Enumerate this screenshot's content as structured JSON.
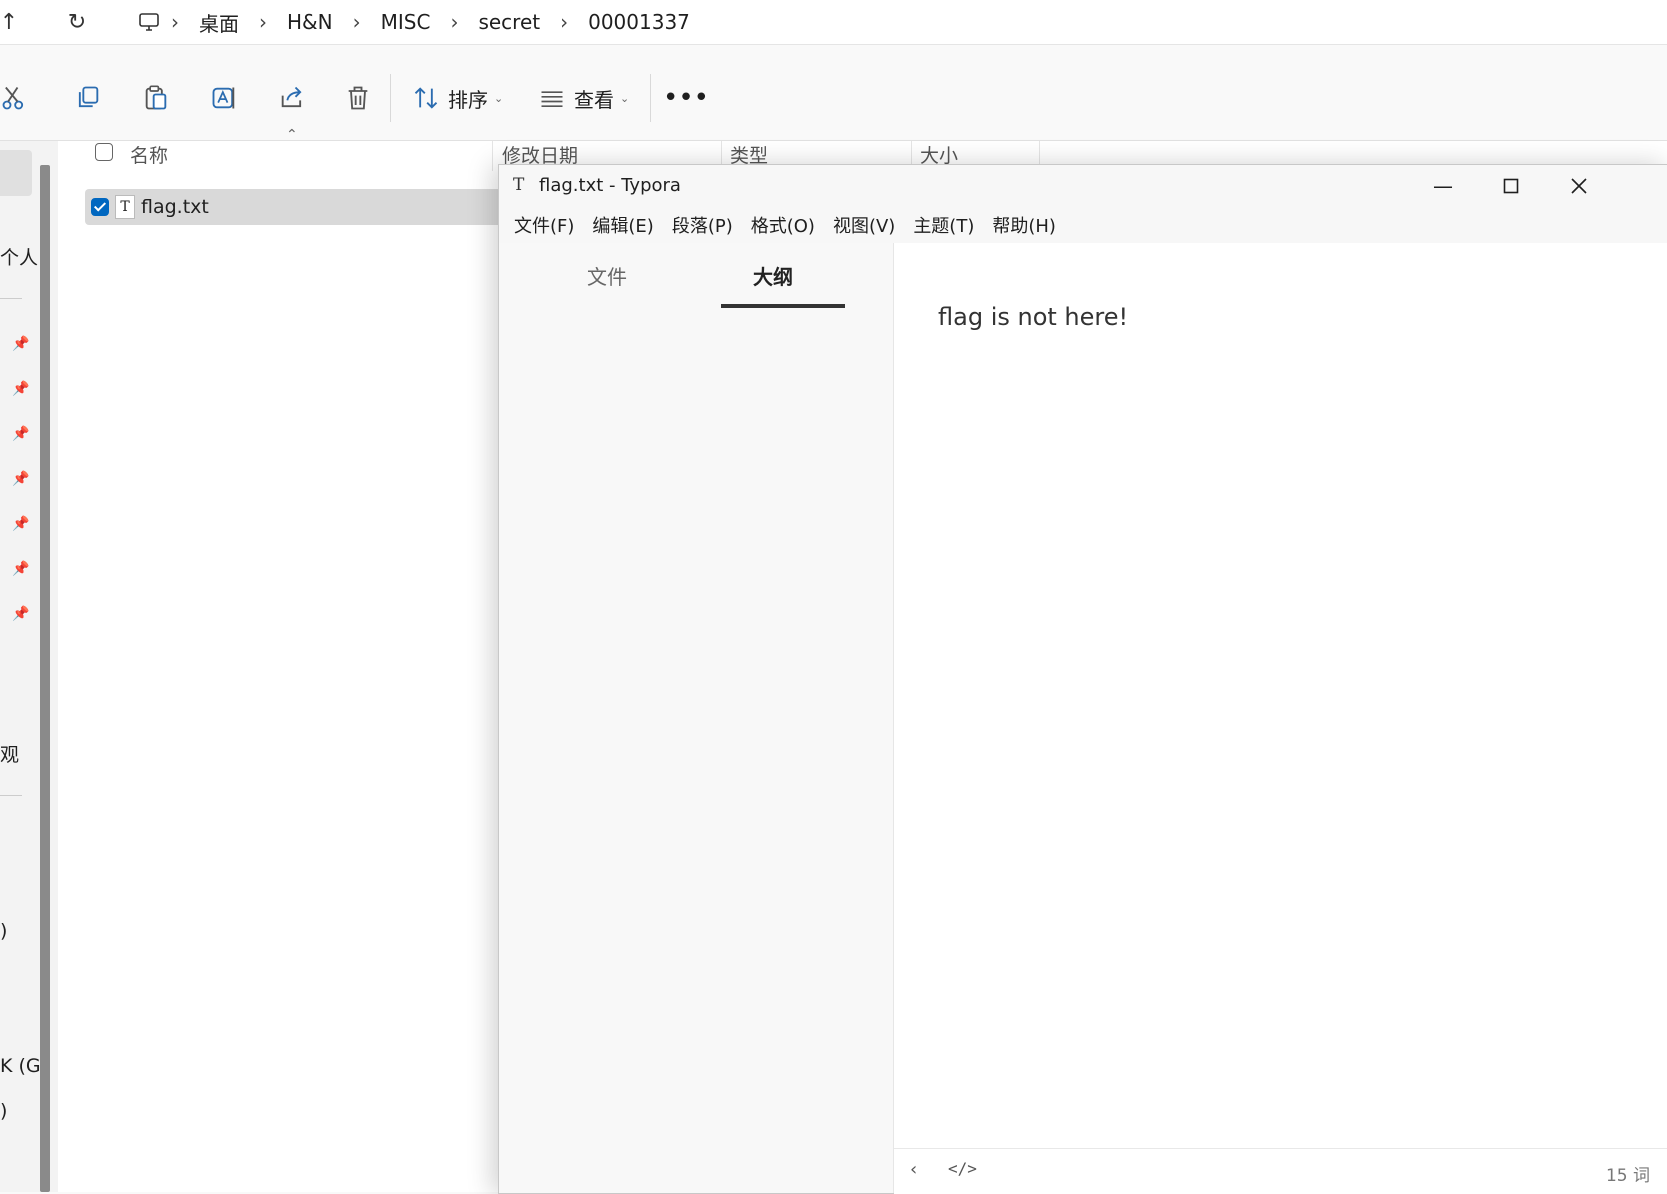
{
  "explorer": {
    "breadcrumb": [
      "桌面",
      "H&N",
      "MISC",
      "secret",
      "00001337"
    ],
    "toolbar": {
      "sort_label": "排序",
      "view_label": "查看"
    },
    "nav_fragments": [
      "个人",
      "观",
      ")",
      "K (G",
      ")"
    ],
    "columns": {
      "name": "名称",
      "modified": "修改日期",
      "type": "类型",
      "size": "大小"
    },
    "files": [
      {
        "name": "flag.txt",
        "selected": true
      }
    ]
  },
  "typora": {
    "title": "flag.txt - Typora",
    "menu": [
      "文件(F)",
      "编辑(E)",
      "段落(P)",
      "格式(O)",
      "视图(V)",
      "主题(T)",
      "帮助(H)"
    ],
    "sidebar_tabs": [
      "文件",
      "大纲"
    ],
    "active_tab": "大纲",
    "content": "flag is not here!",
    "word_count": "15 词"
  },
  "colors": {
    "accent": "#0067c0",
    "selection": "#d9d9d9"
  }
}
